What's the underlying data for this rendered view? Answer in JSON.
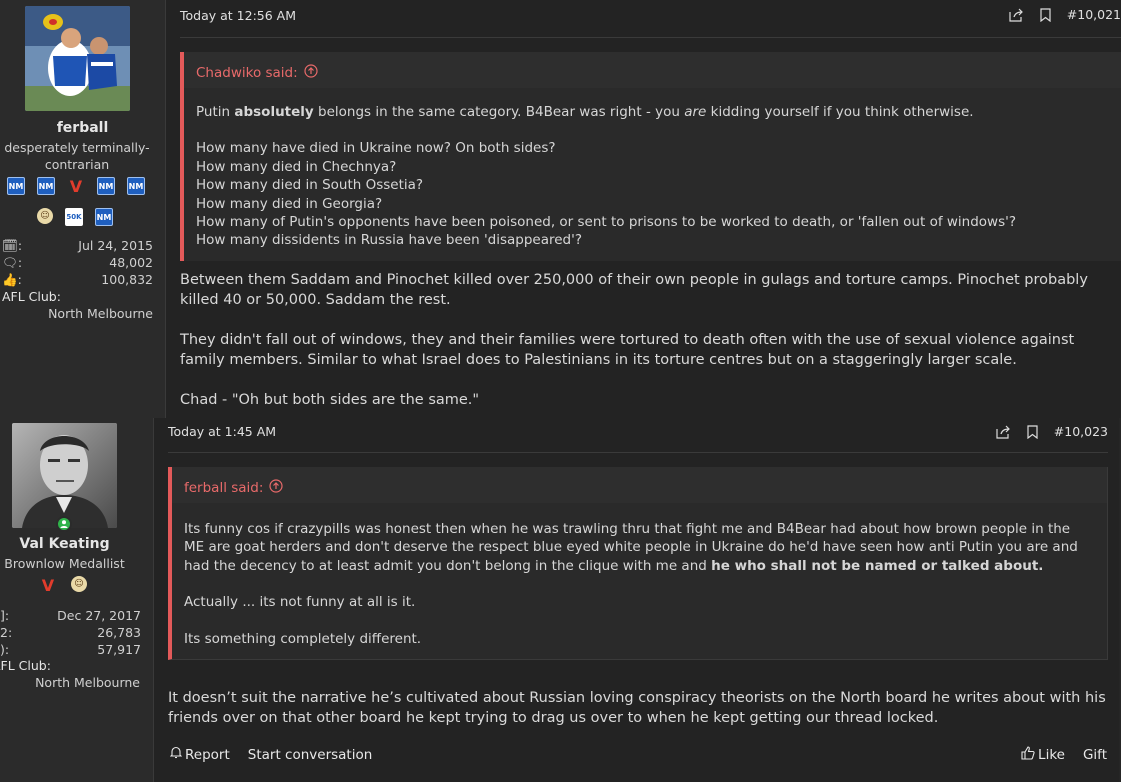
{
  "post1": {
    "user": {
      "name": "ferball",
      "title_line1": "desperately terminally-",
      "title_line2": "contrarian",
      "joined": "Jul 24, 2015",
      "messages": "48,002",
      "reactions": "100,832",
      "club_label": "AFL Club:",
      "club": "North Melbourne"
    },
    "time": "Today at 12:56 AM",
    "post_number": "#10,021",
    "quote": {
      "author": "Chadwiko said:",
      "line1_pre": "Putin ",
      "line1_bold": "absolutely",
      "line1_mid": " belongs in the same category. B4Bear was right - you ",
      "line1_ital": "are",
      "line1_post": " kidding yourself if you think otherwise.",
      "questions": [
        "How many have died in Ukraine now? On both sides?",
        "How many died in Chechnya?",
        "How many died in South Ossetia?",
        "How many died in Georgia?",
        "How many of Putin's opponents have been poisoned, or sent to prisons to be worked to death, or 'fallen out of windows'?",
        "How many dissidents in Russia have been 'disappeared'?"
      ]
    },
    "body": {
      "p1": "Between them Saddam and Pinochet killed over 250,000 of their own people in gulags and torture camps. Pinochet probably killed 40 or 50,000. Saddam the rest.",
      "p2": "They didn't fall out of windows, they and their families were tortured to death often with the use of sexual violence against family members. Similar to what Israel does to Palestinians in its torture centres but on a staggeringly larger scale.",
      "p3": "Chad - \"Oh but both sides are the same.\""
    }
  },
  "post2": {
    "user": {
      "name": "Val Keating",
      "title": "Brownlow Medallist",
      "joined": "Dec 27, 2017",
      "messages": "26,783",
      "reactions": "57,917",
      "club_label": "AFL Club:",
      "club": "North Melbourne"
    },
    "time": "Today at 1:45 AM",
    "post_number": "#10,023",
    "quote": {
      "author": "ferball said:",
      "p1_text": "Its funny cos if crazypills was honest then when he was trawling thru that fight me and B4Bear had about how brown people in the ME are goat herders and don't deserve the respect blue eyed white people in Ukraine do he'd have seen how anti Putin you are and had the decency to at least admit you don't belong in the clique with me and ",
      "p1_bold": "he who shall not be named or talked about.",
      "p2": "Actually ... its not funny at all is it.",
      "p3": "Its something completely different."
    },
    "body": "It doesn’t suit the narrative he’s cultivated about Russian loving conspiracy theorists on the North board he writes about with his friends over on that other board he kept trying to drag us over to when he kept getting our thread locked.",
    "actions": {
      "report": "Report",
      "start_conversation": "Start conversation",
      "like": "Like",
      "gift": "Gift"
    }
  },
  "colors": {
    "quote_accent": "#e35a5a",
    "background": "#262626",
    "online": "#2fb34a"
  }
}
